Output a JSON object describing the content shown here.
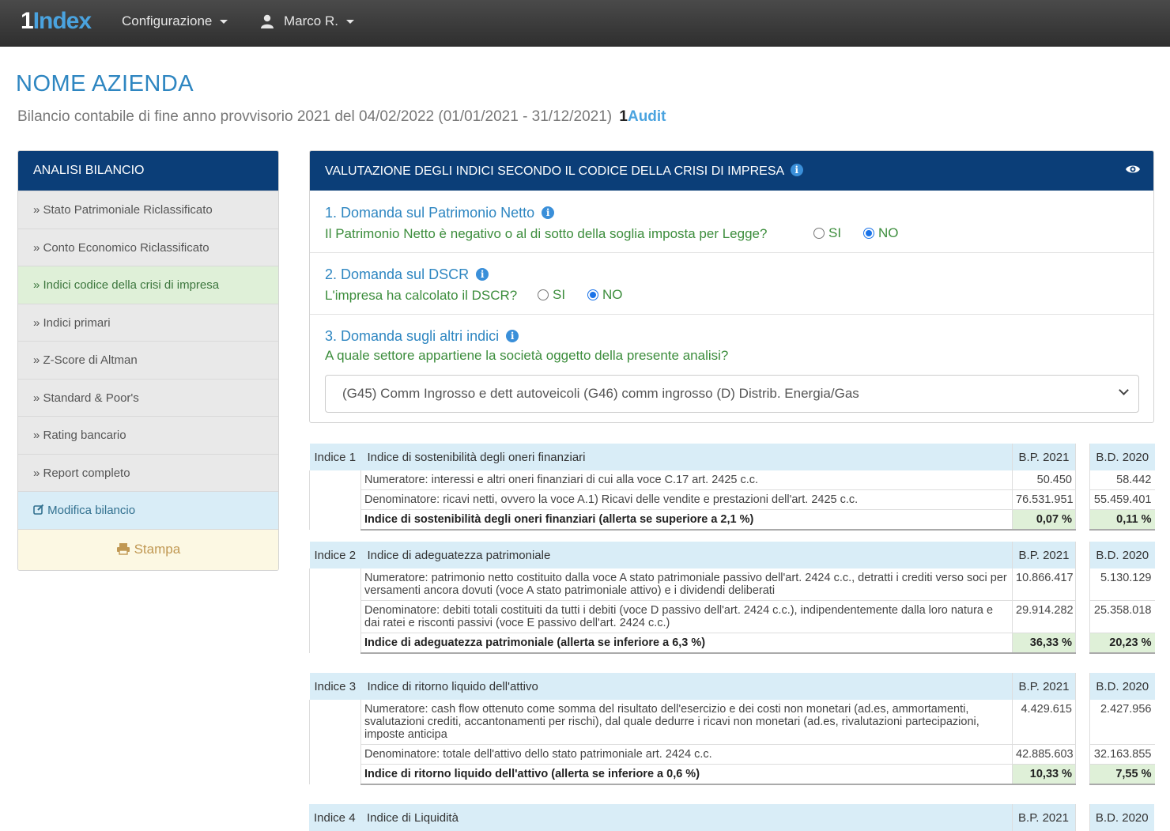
{
  "navbar": {
    "brand_num": "1",
    "brand_text": "Index",
    "menu_config": "Configurazione",
    "user_name": "Marco R."
  },
  "header": {
    "company": "NOME AZIENDA",
    "subtitle": "Bilancio contabile di fine anno provvisorio 2021 del 04/02/2022 (01/01/2021 - 31/12/2021)",
    "audit_num": "1",
    "audit_text": "Audit"
  },
  "sidebar": {
    "title": "ANALISI BILANCIO",
    "items": [
      {
        "label": "» Stato Patrimoniale Riclassificato"
      },
      {
        "label": "» Conto Economico Riclassificato"
      },
      {
        "label": "» Indici codice della crisi di impresa"
      },
      {
        "label": "» Indici primari"
      },
      {
        "label": "» Z-Score di Altman"
      },
      {
        "label": "» Standard & Poor's"
      },
      {
        "label": "» Rating bancario"
      },
      {
        "label": "» Report completo"
      }
    ],
    "edit_label": "Modifica bilancio",
    "print_label": "Stampa"
  },
  "panel": {
    "title": "VALUTAZIONE DEGLI INDICI SECONDO IL CODICE DELLA CRISI DI IMPRESA",
    "q1": {
      "title": "1. Domanda sul Patrimonio Netto",
      "text": "Il Patrimonio Netto è negativo o al di sotto della soglia imposta per Legge?",
      "opt_yes": "SI",
      "opt_no": "NO",
      "selected": "NO"
    },
    "q2": {
      "title": "2. Domanda sul DSCR",
      "text": "L'impresa ha calcolato il DSCR?",
      "opt_yes": "SI",
      "opt_no": "NO",
      "selected": "NO"
    },
    "q3": {
      "title": "3. Domanda sugli altri indici",
      "text": "A quale settore appartiene la società oggetto della presente analisi?",
      "selected": "(G45) Comm Ingrosso e dett autoveicoli (G46) comm ingrosso (D) Distrib. Energia/Gas"
    }
  },
  "indices": [
    {
      "label": "Indice 1",
      "title": "Indice di sostenibilità degli oneri finanziari",
      "col1": "B.P. 2021",
      "col2": "B.D. 2020",
      "num_label": "Numeratore: interessi e altri oneri finanziari di cui alla voce C.17 art. 2425 c.c.",
      "num_v1": "50.450",
      "num_v2": "58.442",
      "den_label": "Denominatore: ricavi netti, ovvero la voce A.1) Ricavi delle vendite e prestazioni dell'art. 2425 c.c.",
      "den_v1": "76.531.951",
      "den_v2": "55.459.401",
      "res_label": "Indice di sostenibilità degli oneri finanziari (allerta se superiore a 2,1 %)",
      "res_v1": "0,07 %",
      "res_v2": "0,11 %"
    },
    {
      "label": "Indice 2",
      "title": "Indice di adeguatezza patrimoniale",
      "col1": "B.P. 2021",
      "col2": "B.D. 2020",
      "num_label": "Numeratore: patrimonio netto costituito dalla voce A stato patrimoniale passivo dell'art. 2424 c.c., detratti i crediti verso soci per versamenti ancora dovuti (voce A stato patrimoniale attivo) e i dividendi deliberati",
      "num_v1": "10.866.417",
      "num_v2": "5.130.129",
      "den_label": "Denominatore: debiti totali costituiti da tutti i debiti (voce D passivo dell'art. 2424 c.c.), indipendentemente dalla loro natura e dai ratei e risconti passivi (voce E passivo dell'art. 2424 c.c.)",
      "den_v1": "29.914.282",
      "den_v2": "25.358.018",
      "res_label": "Indice di adeguatezza patrimoniale (allerta se inferiore a 6,3 %)",
      "res_v1": "36,33 %",
      "res_v2": "20,23 %"
    },
    {
      "label": "Indice 3",
      "title": "Indice di ritorno liquido dell'attivo",
      "col1": "B.P. 2021",
      "col2": "B.D. 2020",
      "num_label": "Numeratore: cash flow ottenuto come somma del risultato dell'esercizio e dei costi non monetari (ad.es, ammortamenti, svalutazioni crediti, accantonamenti per rischi), dal quale dedurre i ricavi non monetari (ad.es, rivalutazioni partecipazioni, imposte anticipa",
      "num_v1": "4.429.615",
      "num_v2": "2.427.956",
      "den_label": "Denominatore: totale dell'attivo dello stato patrimoniale art. 2424 c.c.",
      "den_v1": "42.885.603",
      "den_v2": "32.163.855",
      "res_label": "Indice di ritorno liquido dell'attivo (allerta se inferiore a 0,6 %)",
      "res_v1": "10,33 %",
      "res_v2": "7,55 %"
    },
    {
      "label": "Indice 4",
      "title": "Indice di Liquidità",
      "col1": "B.P. 2021",
      "col2": "B.D. 2020"
    }
  ]
}
